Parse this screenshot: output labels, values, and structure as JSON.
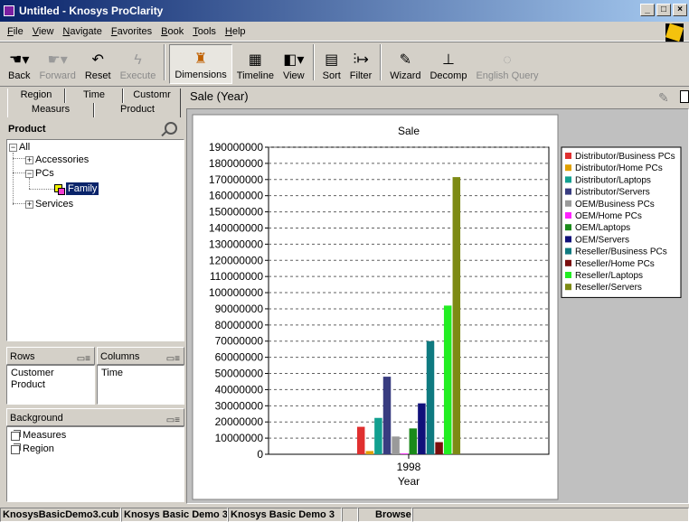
{
  "window": {
    "title": "Untitled - Knosys ProClarity"
  },
  "menu": [
    "File",
    "View",
    "Navigate",
    "Favorites",
    "Book",
    "Tools",
    "Help"
  ],
  "toolbar": {
    "back": "Back",
    "forward": "Forward",
    "reset": "Reset",
    "execute": "Execute",
    "dimensions": "Dimensions",
    "timeline": "Timeline",
    "view": "View",
    "sort": "Sort",
    "filter": "Filter",
    "wizard": "Wizard",
    "decomp": "Decomp",
    "english_query": "English Query"
  },
  "tabs": {
    "row1": [
      "Region",
      "Time",
      "Customr"
    ],
    "row2": [
      "Measurs",
      "Product"
    ]
  },
  "view_title": "Sale (Year)",
  "product_panel": {
    "title": "Product",
    "tree": {
      "all": "All",
      "accessories": "Accessories",
      "pcs": "PCs",
      "family": "Family",
      "services": "Services"
    }
  },
  "rows": {
    "title": "Rows",
    "items": [
      "Customer",
      "Product"
    ]
  },
  "columns": {
    "title": "Columns",
    "items": [
      "Time"
    ]
  },
  "background": {
    "title": "Background",
    "items": [
      "Measures",
      "Region"
    ]
  },
  "chart_data": {
    "type": "bar",
    "title": "Sale",
    "xlabel": "Year",
    "categories": [
      "1998"
    ],
    "ylim": [
      0,
      190000000
    ],
    "yticks": [
      0,
      10000000,
      20000000,
      30000000,
      40000000,
      50000000,
      60000000,
      70000000,
      80000000,
      90000000,
      100000000,
      110000000,
      120000000,
      130000000,
      140000000,
      150000000,
      160000000,
      170000000,
      180000000,
      190000000
    ],
    "grid": true,
    "legend": "right",
    "series": [
      {
        "name": "Distributor/Business PCs",
        "color": "#e03030",
        "values": [
          17000000
        ]
      },
      {
        "name": "Distributor/Home PCs",
        "color": "#e0a000",
        "values": [
          2000000
        ]
      },
      {
        "name": "Distributor/Laptops",
        "color": "#12a090",
        "values": [
          22500000
        ]
      },
      {
        "name": "Distributor/Servers",
        "color": "#383c80",
        "values": [
          48000000
        ]
      },
      {
        "name": "OEM/Business PCs",
        "color": "#9a9a9a",
        "values": [
          11000000
        ]
      },
      {
        "name": "OEM/Home PCs",
        "color": "#ff22ff",
        "values": [
          500000
        ]
      },
      {
        "name": "OEM/Laptops",
        "color": "#1a8a1a",
        "values": [
          16000000
        ]
      },
      {
        "name": "OEM/Servers",
        "color": "#10107a",
        "values": [
          31500000
        ]
      },
      {
        "name": "Reseller/Business PCs",
        "color": "#0f7a80",
        "values": [
          70000000
        ]
      },
      {
        "name": "Reseller/Home PCs",
        "color": "#7a0e0e",
        "values": [
          7500000
        ]
      },
      {
        "name": "Reseller/Laptops",
        "color": "#22ee22",
        "values": [
          92000000
        ]
      },
      {
        "name": "Reseller/Servers",
        "color": "#7d8a14",
        "values": [
          171500000
        ]
      }
    ]
  },
  "status": {
    "cells": [
      "KnosysBasicDemo3.cub",
      "Knosys Basic Demo 3",
      "Knosys Basic Demo 3",
      "",
      "Browse"
    ]
  }
}
